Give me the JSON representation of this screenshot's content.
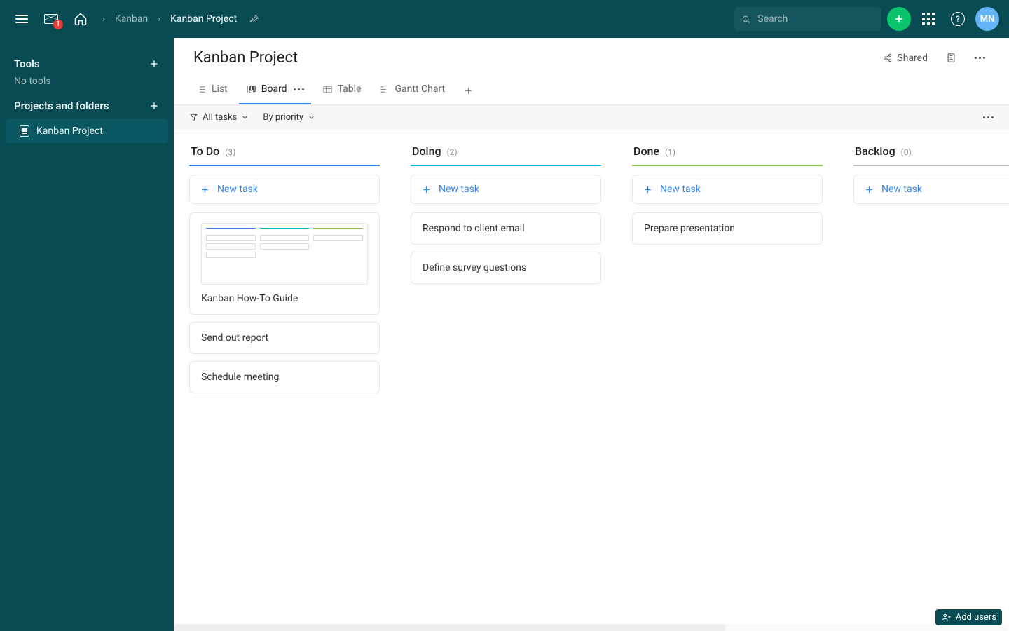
{
  "topbar": {
    "mail_badge": "1",
    "breadcrumb": [
      "Kanban",
      "Kanban Project"
    ],
    "search_placeholder": "Search",
    "avatar": "MN"
  },
  "sidebar": {
    "tools_header": "Tools",
    "tools_empty": "No tools",
    "projects_header": "Projects and folders",
    "project_item": "Kanban Project"
  },
  "page": {
    "title": "Kanban Project",
    "shared_label": "Shared"
  },
  "tabs": {
    "list": "List",
    "board": "Board",
    "table": "Table",
    "gantt": "Gantt Chart"
  },
  "filters": {
    "all": "All tasks",
    "sort": "By priority"
  },
  "new_task_label": "New task",
  "columns": [
    {
      "key": "todo",
      "title": "To Do",
      "count": "(3)",
      "color": "#2f80ed",
      "tasks": [
        {
          "title": "Kanban How-To Guide",
          "thumb": true
        },
        {
          "title": "Send out report"
        },
        {
          "title": "Schedule meeting"
        }
      ]
    },
    {
      "key": "doing",
      "title": "Doing",
      "count": "(2)",
      "color": "#00b7d4",
      "tasks": [
        {
          "title": "Respond to client email"
        },
        {
          "title": "Define survey questions"
        }
      ]
    },
    {
      "key": "done",
      "title": "Done",
      "count": "(1)",
      "color": "#8bc34a",
      "tasks": [
        {
          "title": "Prepare presentation"
        }
      ]
    },
    {
      "key": "backlog",
      "title": "Backlog",
      "count": "(0)",
      "color": "#bdbdbd",
      "tasks": []
    }
  ],
  "add_users": "Add users"
}
